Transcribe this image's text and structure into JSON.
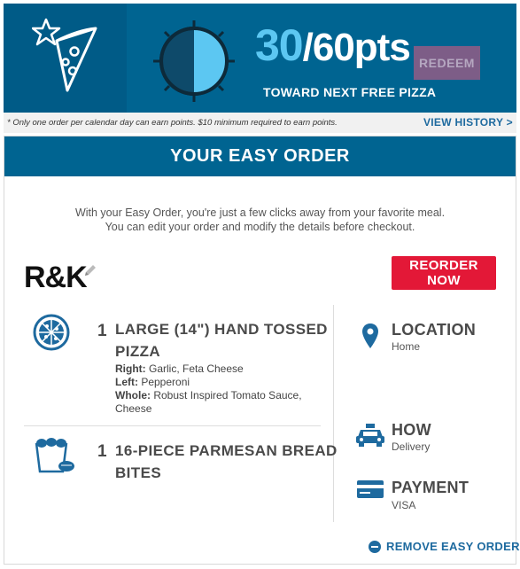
{
  "rewards": {
    "points_current": "30",
    "points_total": "/60pts",
    "progress_fraction": 0.5,
    "subtitle": "TOWARD NEXT FREE PIZZA",
    "redeem_label": "REDEEM"
  },
  "note": {
    "text": "* Only one order per calendar day can earn points. $10 minimum required to earn points.",
    "history_label": "VIEW HISTORY >"
  },
  "easy_order": {
    "title": "YOUR EASY ORDER",
    "intro_line1": "With your Easy Order, you're just a few clicks away from your favorite meal.",
    "intro_line2": "You can edit your order and modify the details before checkout.",
    "order_name": "R&K",
    "reorder_label": "REORDER NOW",
    "items": [
      {
        "qty": "1",
        "name_line1": "LARGE (14\") HAND TOSSED",
        "name_line2": "PIZZA",
        "details": [
          {
            "label": "Right:",
            "value": " Garlic, Feta Cheese"
          },
          {
            "label": "Left:",
            "value": " Pepperoni"
          },
          {
            "label": "Whole:",
            "value": " Robust Inspired Tomato Sauce,"
          },
          {
            "label": "",
            "value": "Cheese"
          }
        ]
      },
      {
        "qty": "1",
        "name_line1": "16-PIECE PARMESAN BREAD",
        "name_line2": "BITES"
      }
    ],
    "location": {
      "label": "LOCATION",
      "value": "Home"
    },
    "how": {
      "label": "HOW",
      "value": "Delivery"
    },
    "payment": {
      "label": "PAYMENT",
      "value": "VISA"
    },
    "remove_label": "REMOVE EASY ORDER"
  },
  "colors": {
    "brand_blue": "#006491",
    "accent_light_blue": "#5cc7f2",
    "reorder_red": "#e31837",
    "redeem_purple": "#7d5d87",
    "link_blue": "#1e6a9f"
  }
}
